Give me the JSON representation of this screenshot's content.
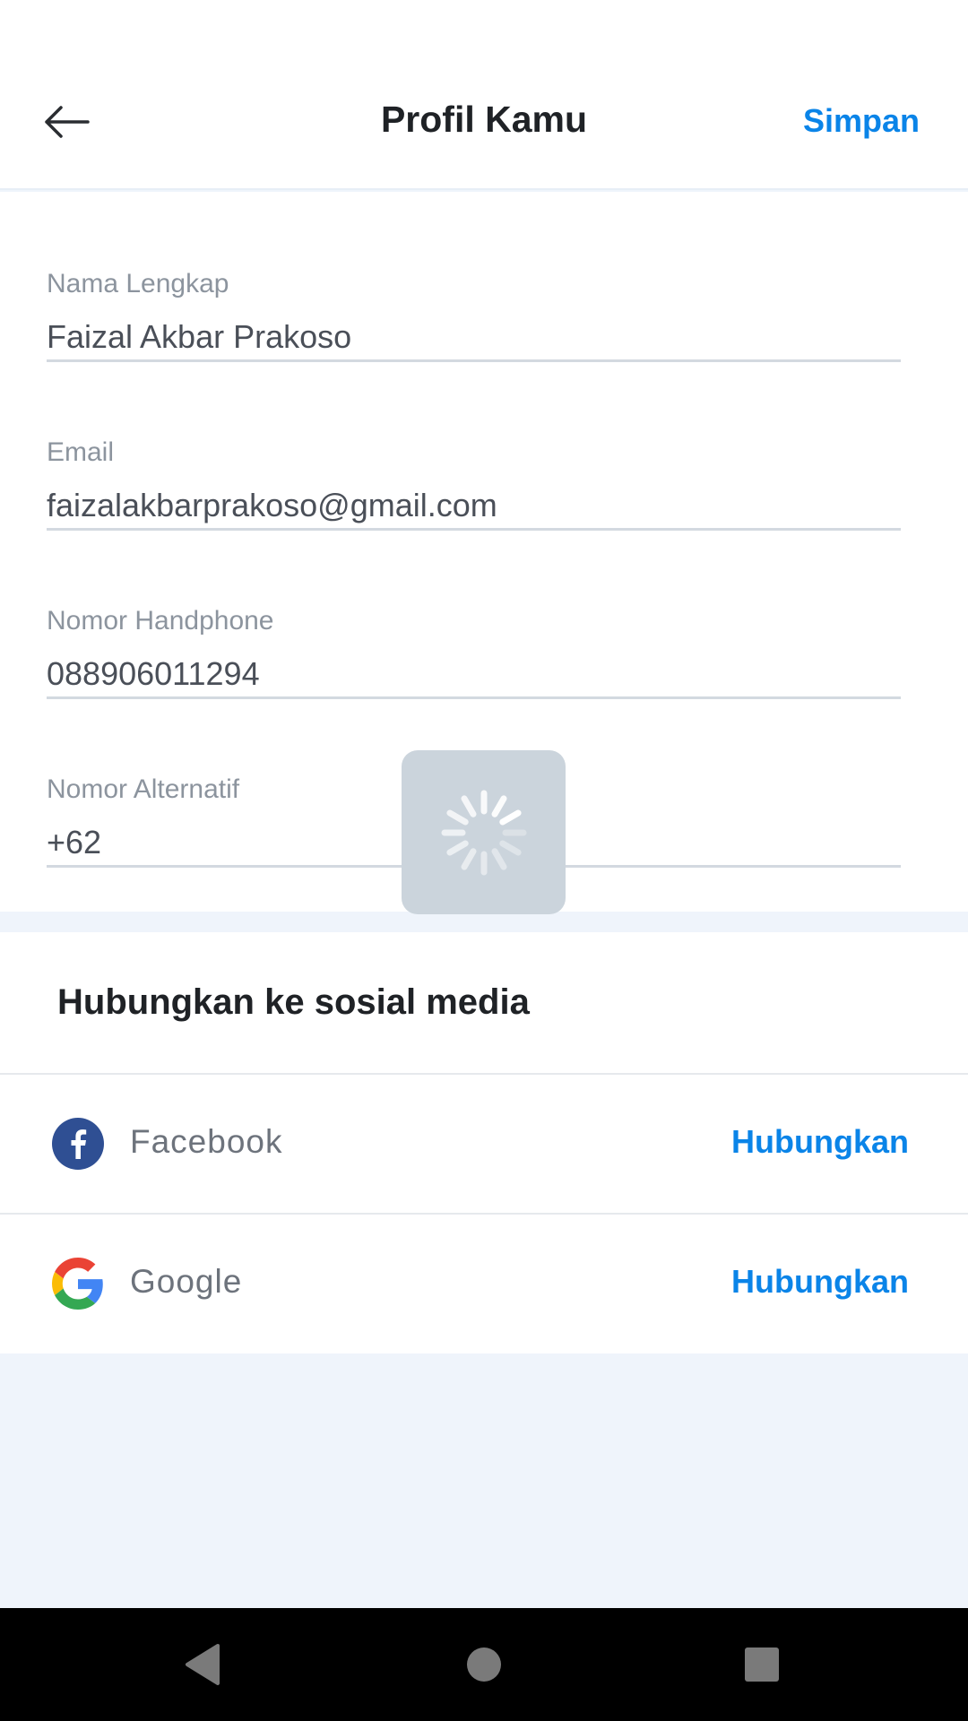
{
  "header": {
    "title": "Profil Kamu",
    "save_label": "Simpan"
  },
  "form": {
    "fields": [
      {
        "label": "Nama Lengkap",
        "value": "Faizal Akbar Prakoso"
      },
      {
        "label": "Email",
        "value": "faizalakbarprakoso@gmail.com"
      },
      {
        "label": "Nomor Handphone",
        "value": "088906011294"
      },
      {
        "label": "Nomor Alternatif",
        "value": "+62"
      }
    ]
  },
  "social": {
    "title": "Hubungkan ke sosial media",
    "items": [
      {
        "name": "Facebook",
        "action": "Hubungkan",
        "icon": "facebook-icon"
      },
      {
        "name": "Google",
        "action": "Hubungkan",
        "icon": "google-icon"
      }
    ]
  },
  "colors": {
    "accent": "#0a84e8",
    "facebook": "#2f4f93",
    "background": "#eff4fb"
  }
}
